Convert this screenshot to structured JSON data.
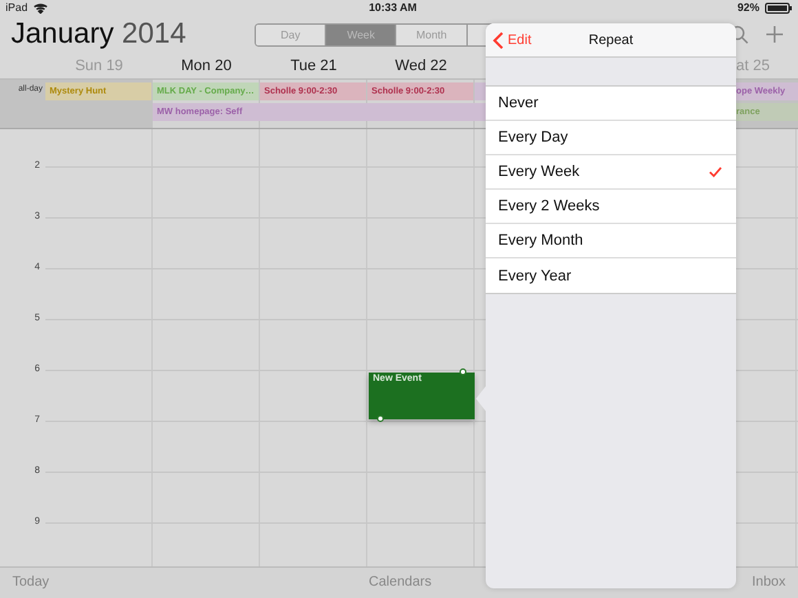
{
  "status_bar": {
    "device": "iPad",
    "time": "10:33 AM",
    "battery": "92%"
  },
  "header": {
    "month": "January",
    "year": "2014"
  },
  "view_switch": [
    {
      "label": "Day",
      "selected": false
    },
    {
      "label": "Week",
      "selected": true
    },
    {
      "label": "Month",
      "selected": false
    }
  ],
  "all_day": {
    "label": "all-day"
  },
  "days": [
    {
      "label": "Sun 19",
      "muted": true,
      "events": [
        {
          "title": "Mystery Hunt",
          "color": "#d8cda6"
        }
      ]
    },
    {
      "label": "Mon 20",
      "muted": false,
      "events": [
        {
          "title": "MLK DAY - Company…",
          "color": "#c0d6b8"
        },
        {
          "title": "MW homepage: Seff",
          "color": "#cfbdd3"
        }
      ]
    },
    {
      "label": "Tue 21",
      "muted": false,
      "events": [
        {
          "title": "Scholle 9:00-2:30",
          "color": "#dbb4bd"
        },
        {
          "continues": true
        }
      ]
    },
    {
      "label": "Wed 22",
      "muted": false,
      "events": [
        {
          "title": "Scholle 9:00-2:30",
          "color": "#dbb4bd"
        },
        {
          "continues": true
        }
      ]
    },
    {
      "events": [
        {
          "color": "#cfbdd3"
        },
        {
          "continues": true
        }
      ]
    },
    {
      "label": "at 25",
      "muted": true,
      "events": [
        {
          "title": "ope Weekly",
          "color": "#cfbdd3"
        },
        {
          "title": "rance",
          "color": "#c0cbb6"
        }
      ]
    }
  ],
  "hours": [
    "2",
    "3",
    "4",
    "5",
    "6",
    "7",
    "8",
    "9"
  ],
  "event": {
    "title": "New Event"
  },
  "popover": {
    "back": "Edit",
    "title": "Repeat",
    "options": [
      {
        "label": "Never",
        "selected": false
      },
      {
        "label": "Every Day",
        "selected": false
      },
      {
        "label": "Every Week",
        "selected": true
      },
      {
        "label": "Every 2 Weeks",
        "selected": false
      },
      {
        "label": "Every Month",
        "selected": false
      },
      {
        "label": "Every Year",
        "selected": false
      }
    ]
  },
  "toolbar": [
    "Today",
    "Calendars",
    "Inbox"
  ]
}
